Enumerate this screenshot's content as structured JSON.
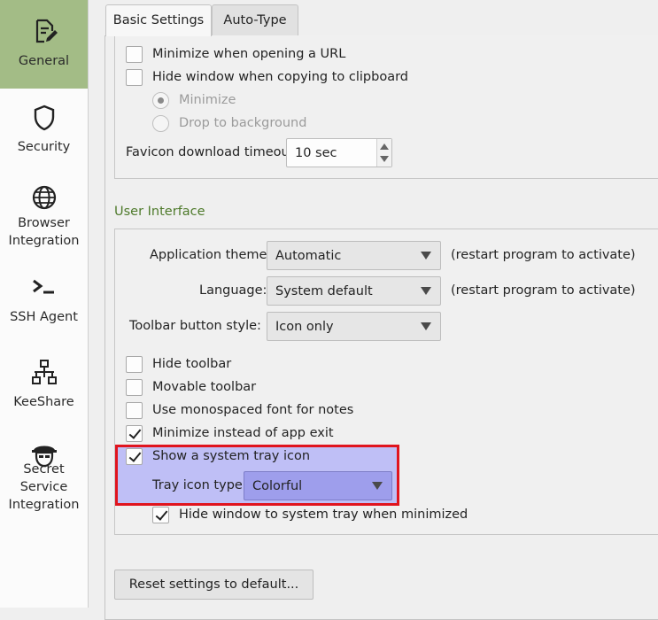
{
  "sidebar": {
    "items": [
      {
        "label": "General",
        "icon": "document-edit-icon"
      },
      {
        "label": "Security",
        "icon": "shield-icon"
      },
      {
        "label": "Browser\nIntegration",
        "icon": "globe-icon"
      },
      {
        "label": "SSH Agent",
        "icon": "terminal-prompt-icon"
      },
      {
        "label": "KeeShare",
        "icon": "network-share-icon"
      },
      {
        "label": "Secret\nService\nIntegration",
        "icon": "secret-agent-icon"
      }
    ],
    "selected_color": "#a3bc86"
  },
  "tabs": [
    {
      "label": "Basic Settings"
    },
    {
      "label": "Auto-Type"
    }
  ],
  "group1": {
    "minimize_url": {
      "label": "Minimize when opening a URL",
      "checked": false
    },
    "hide_clipboard": {
      "label": "Hide window when copying to clipboard",
      "checked": false
    },
    "radio_minimize": {
      "label": "Minimize",
      "selected": true,
      "enabled": false
    },
    "radio_background": {
      "label": "Drop to background",
      "selected": false,
      "enabled": false
    },
    "favicon_label": "Favicon download timeout:",
    "favicon_value": "10 sec"
  },
  "ui": {
    "section_title": "User Interface",
    "theme_label": "Application theme:",
    "theme_value": "Automatic",
    "theme_note": "(restart program to activate)",
    "language_label": "Language:",
    "language_value": "System default",
    "language_note": "(restart program to activate)",
    "toolbar_style_label": "Toolbar button style:",
    "toolbar_style_value": "Icon only",
    "hide_toolbar": {
      "label": "Hide toolbar",
      "checked": false
    },
    "movable_toolbar": {
      "label": "Movable toolbar",
      "checked": false
    },
    "monospace": {
      "label": "Use monospaced font for notes",
      "checked": false
    },
    "minimize_exit": {
      "label": "Minimize instead of app exit",
      "checked": true
    },
    "tray_icon": {
      "label": "Show a system tray icon",
      "checked": true
    },
    "tray_type_label": "Tray icon type:",
    "tray_type_value": "Colorful",
    "hide_to_tray": {
      "label": "Hide window to system tray when minimized",
      "checked": true
    }
  },
  "reset_label": "Reset settings to default...",
  "colors": {
    "section_title": "#4e7a2b",
    "highlight_border": "#e0141e",
    "highlight_fill": "#bfbff6"
  }
}
